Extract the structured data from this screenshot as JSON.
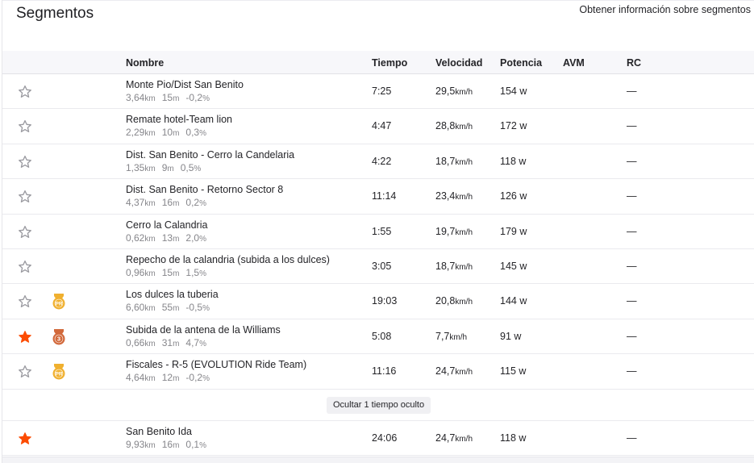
{
  "header": {
    "title": "Segmentos",
    "help_link": "Obtener información sobre segmentos"
  },
  "columns": {
    "name": "Nombre",
    "time": "Tiempo",
    "speed": "Velocidad",
    "power": "Potencia",
    "avm": "AVM",
    "rc": "RC"
  },
  "units": {
    "km": "km",
    "m": "m",
    "pct": "%",
    "kmh": "km/h",
    "w": "w"
  },
  "colors": {
    "starred": "#fc4c02",
    "star_outline": "#9a9aa0",
    "pr_gold": "#f0b02f",
    "podium_bronze": "#d2693b"
  },
  "rows": [
    {
      "starred": false,
      "badge": "",
      "name": "Monte Pio/Dist San Benito",
      "distance": "3,64",
      "elevation": "15",
      "grade": "-0,2",
      "time": "7:25",
      "speed": "29,5",
      "power": "154",
      "rc": "—"
    },
    {
      "starred": false,
      "badge": "",
      "name": "Remate hotel-Team lion",
      "distance": "2,29",
      "elevation": "10",
      "grade": "0,3",
      "time": "4:47",
      "speed": "28,8",
      "power": "172",
      "rc": "—"
    },
    {
      "starred": false,
      "badge": "",
      "name": "Dist. San Benito - Cerro la Candelaria",
      "distance": "1,35",
      "elevation": "9",
      "grade": "0,5",
      "time": "4:22",
      "speed": "18,7",
      "power": "118",
      "rc": "—"
    },
    {
      "starred": false,
      "badge": "",
      "name": "Dist. San Benito - Retorno Sector 8",
      "distance": "4,37",
      "elevation": "16",
      "grade": "0,2",
      "time": "11:14",
      "speed": "23,4",
      "power": "126",
      "rc": "—"
    },
    {
      "starred": false,
      "badge": "",
      "name": "Cerro la Calandria",
      "distance": "0,62",
      "elevation": "13",
      "grade": "2,0",
      "time": "1:55",
      "speed": "19,7",
      "power": "179",
      "rc": "—"
    },
    {
      "starred": false,
      "badge": "",
      "name": "Repecho de la calandria (subida a los dulces)",
      "distance": "0,96",
      "elevation": "15",
      "grade": "1,5",
      "time": "3:05",
      "speed": "18,7",
      "power": "145",
      "rc": "—"
    },
    {
      "starred": false,
      "badge": "PR",
      "name": "Los dulces la tuberia",
      "distance": "6,60",
      "elevation": "55",
      "grade": "-0,5",
      "time": "19:03",
      "speed": "20,8",
      "power": "144",
      "rc": "—"
    },
    {
      "starred": true,
      "badge": "3",
      "name": "Subida de la antena de la Williams",
      "distance": "0,66",
      "elevation": "31",
      "grade": "4,7",
      "time": "5:08",
      "speed": "7,7",
      "power": "91",
      "rc": "—"
    },
    {
      "starred": false,
      "badge": "PR",
      "name": "Fiscales - R-5 (EVOLUTION Ride Team)",
      "distance": "4,64",
      "elevation": "12",
      "grade": "-0,2",
      "time": "11:16",
      "speed": "24,7",
      "power": "115",
      "rc": "—"
    }
  ],
  "toggle_hidden": "Ocultar 1 tiempo oculto",
  "hidden_rows": [
    {
      "starred": true,
      "badge": "",
      "name": "San Benito Ida",
      "distance": "9,93",
      "elevation": "16",
      "grade": "0,1",
      "time": "24:06",
      "speed": "24,7",
      "power": "118",
      "rc": "—"
    }
  ]
}
